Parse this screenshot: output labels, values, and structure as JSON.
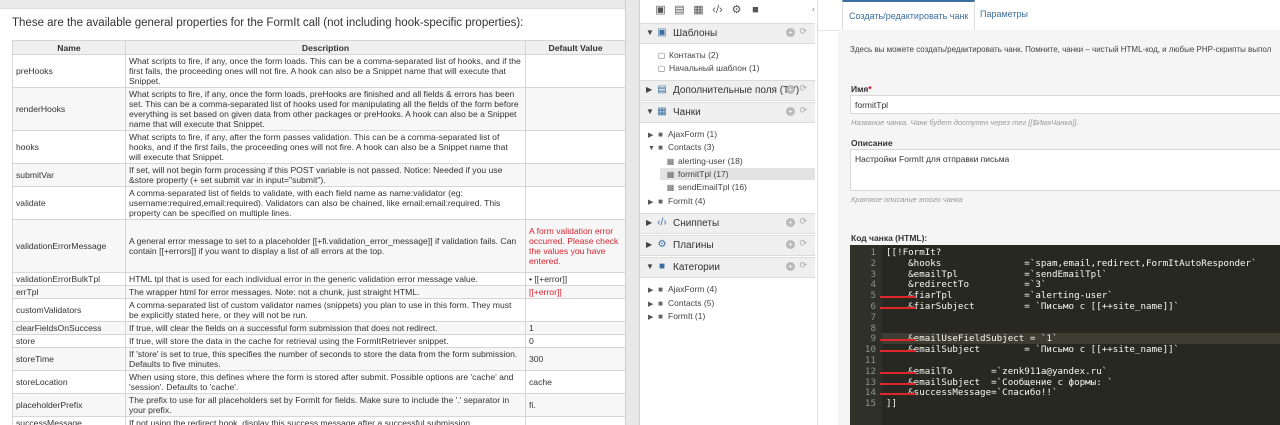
{
  "docs": {
    "intro": "These are the available general properties for the FormIt call (not including hook-specific properties):",
    "columns": [
      "Name",
      "Description",
      "Default Value"
    ],
    "rows": [
      {
        "name": "preHooks",
        "desc": "What scripts to fire, if any, once the form loads. This can be a comma-separated list of hooks, and if the first fails, the proceeding ones will not fire. A hook can also be a Snippet name that will execute that Snippet.",
        "default": ""
      },
      {
        "name": "renderHooks",
        "desc": "What scripts to fire, if any, once the form loads, preHooks are finished and all fields & errors has been set. This can be a comma-separated list of hooks used for manipulating all the fields of the form before everything is set based on given data from other packages or preHooks. A hook can also be a Snippet name that will execute that Snippet.",
        "default": ""
      },
      {
        "name": "hooks",
        "desc": "What scripts to fire, if any, after the form passes validation. This can be a comma-separated list of hooks, and if the first fails, the proceeding ones will not fire. A hook can also be a Snippet name that will execute that Snippet.",
        "default": ""
      },
      {
        "name": "submitVar",
        "desc": "If set, will not begin form processing if this POST variable is not passed. Notice: Needed if you use &store property (+ set submit var in input=\"submit\").",
        "default": ""
      },
      {
        "name": "validate",
        "desc": "A comma-separated list of fields to validate, with each field name as name:validator (eg: username:required,email:required). Validators can also be chained, like email:email:required. This property can be specified on multiple lines.",
        "default": ""
      },
      {
        "name": "validationErrorMessage",
        "desc": "A general error message to set to a placeholder [[+fi.validation_error_message]] if validation fails. Can contain [[+errors]] if you want to display a list of all errors at the top.",
        "default": "A form validation error occurred. Please check the values you have entered."
      },
      {
        "name": "validationErrorBulkTpl",
        "desc": "HTML tpl that is used for each individual error in the generic validation error message value.",
        "default": "•   [[+error]]"
      },
      {
        "name": "errTpl",
        "desc": "The wrapper html for error messages. Note: not a chunk, just straight HTML.",
        "default": "[[+error]]"
      },
      {
        "name": "customValidators",
        "desc": "A comma-separated list of custom validator names (snippets) you plan to use in this form. They must be explicitly stated here, or they will not be run.",
        "default": ""
      },
      {
        "name": "clearFieldsOnSuccess",
        "desc": "If true, will clear the fields on a successful form submission that does not redirect.",
        "default": "1"
      },
      {
        "name": "store",
        "desc": "If true, will store the data in the cache for retrieval using the FormItRetriever snippet.",
        "default": "0"
      },
      {
        "name": "storeTime",
        "desc": "If 'store' is set to true, this specifies the number of seconds to store the data from the form submission. Defaults to five minutes.",
        "default": "300"
      },
      {
        "name": "storeLocation",
        "desc": "When using store, this defines where the form is stored after submit. Possible options are 'cache' and 'session'. Defaults to 'cache'.",
        "default": "cache"
      },
      {
        "name": "placeholderPrefix",
        "desc": "The prefix to use for all placeholders set by FormIt for fields. Make sure to include the '.' separator in your prefix.",
        "default": "fi."
      },
      {
        "name": "successMessage",
        "desc": "If not using the redirect hook, display this success message after a successful submission.",
        "default": ""
      },
      {
        "name": "successMessagePlaceholder",
        "desc": "The name of the placeholder to set the success message to.",
        "default": "fi.successMessage"
      }
    ]
  },
  "tree": {
    "sections": [
      {
        "label": "Шаблоны",
        "icon": "template-icon"
      },
      {
        "label": "Дополнительные поля (TV)",
        "icon": "tv-icon"
      },
      {
        "label": "Чанки",
        "icon": "chunks-icon"
      },
      {
        "label": "Сниппеты",
        "icon": "snippet-icon"
      },
      {
        "label": "Плагины",
        "icon": "plugin-icon"
      },
      {
        "label": "Категории",
        "icon": "folder-icon"
      }
    ],
    "templates": [
      "Контакты (2)",
      "Начальный шаблон (1)"
    ],
    "chunks": [
      "AjaxForm (1)",
      "Contacts (3)",
      "alerting-user (18)",
      "formitTpl (17)",
      "sendEmailTpl (16)",
      "FormIt (4)"
    ],
    "categories": [
      "AjaxForm (4)",
      "Contacts (5)",
      "FormIt (1)"
    ]
  },
  "editor": {
    "tab_active": "Создать/редактировать чанк",
    "tab_inactive": "Параметры",
    "hint": "Здесь вы можете создать/редактировать чанк. Помните, чанки – чистый HTML-код, и любые PHP-скрипты выпол",
    "name_label": "Имя",
    "name_required": "*",
    "name_value": "formitTpl",
    "name_help": "Название чанка. Чанк будет доступен через тег [[$ИмяЧанка]].",
    "desc_label": "Описание",
    "desc_value": "Настройки FormIt для отправки письма",
    "desc_help": "Краткое описание этого чанка",
    "code_label": "Код чанка (HTML):"
  },
  "code_lines": [
    {
      "n": "1",
      "t": "[[!FormIt?"
    },
    {
      "n": "2",
      "t": "    &hooks               =`spam,email,redirect,FormItAutoResponder`"
    },
    {
      "n": "3",
      "t": "    &emailTpl            =`sendEmailTpl`"
    },
    {
      "n": "4",
      "t": "    &redirectTo          =`3`"
    },
    {
      "n": "5",
      "t": "    &fiarTpl             =`alerting-user`"
    },
    {
      "n": "6",
      "t": "    &fiarSubject         = `Письмо с [[++site_name]]`"
    },
    {
      "n": "7",
      "t": ""
    },
    {
      "n": "8",
      "t": ""
    },
    {
      "n": "9",
      "t": "    &emailUseFieldSubject = `1`"
    },
    {
      "n": "10",
      "t": "    &emailSubject        = `Письмо с [[++site_name]]`"
    },
    {
      "n": "11",
      "t": ""
    },
    {
      "n": "12",
      "t": "    &emailTo       =`zenk911a@yandex.ru`"
    },
    {
      "n": "13",
      "t": "    &emailSubject  =`Сообщение с формы: `"
    },
    {
      "n": "14",
      "t": "    &successMessage=`Спасибо!!`"
    },
    {
      "n": "15",
      "t": "]]"
    }
  ]
}
